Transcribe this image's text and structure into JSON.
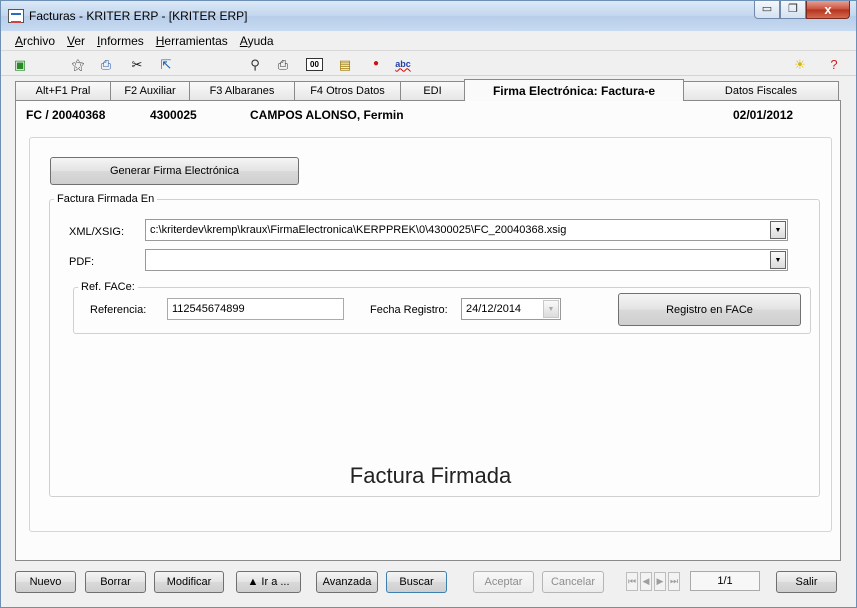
{
  "window": {
    "title": "Facturas - KRITER ERP - [KRITER ERP]",
    "minimize_glyph": "▭",
    "restore_glyph": "❐",
    "close_glyph": "x"
  },
  "menu": [
    {
      "label": "Archivo"
    },
    {
      "label": "Ver"
    },
    {
      "label": "Informes"
    },
    {
      "label": "Herramientas"
    },
    {
      "label": "Ayuda"
    }
  ],
  "toolbar": {
    "icons": [
      "book-icon",
      "runner-icon",
      "print-icon",
      "scissors-icon",
      "export-icon",
      "preview-icon",
      "printer-icon",
      "counter-icon",
      "folder-icon",
      "record-icon",
      "spellcheck-icon",
      "lightbulb-icon",
      "help-icon"
    ],
    "counter_text": "00",
    "spell_text": "abc"
  },
  "tabs": [
    {
      "label": "Alt+F1 Pral"
    },
    {
      "label": "F2 Auxiliar"
    },
    {
      "label": "F3 Albaranes"
    },
    {
      "label": "F4 Otros Datos"
    },
    {
      "label": "EDI"
    },
    {
      "label": "Firma Electrónica: Factura-e",
      "active": true
    },
    {
      "label": "Datos Fiscales"
    }
  ],
  "invoice": {
    "number": "FC / 20040368",
    "account": "4300025",
    "client": "CAMPOS ALONSO, Fermin",
    "date": "02/01/2012"
  },
  "firma": {
    "generate_button": "Generar Firma Electrónica",
    "group_title": "Factura Firmada En",
    "xml_label": "XML/XSIG:",
    "xml_value": "c:\\kriterdev\\kremp\\kraux\\FirmaElectronica\\KERPPREK\\0\\4300025\\FC_20040368.xsig",
    "pdf_label": "PDF:",
    "pdf_value": "",
    "face_group_title": "Ref. FACe:",
    "referencia_label": "Referencia:",
    "referencia_value": "112545674899",
    "fecha_label": "Fecha Registro:",
    "fecha_value": "24/12/2014",
    "registro_button": "Registro en FACe",
    "caption": "Factura Firmada"
  },
  "bottom": {
    "nuevo": "Nuevo",
    "borrar": "Borrar",
    "modificar": "Modificar",
    "ira": "▲ Ir a ...",
    "avanzada": "Avanzada",
    "buscar": "Buscar",
    "aceptar": "Aceptar",
    "cancelar": "Cancelar",
    "record": "1/1",
    "salir": "Salir"
  }
}
